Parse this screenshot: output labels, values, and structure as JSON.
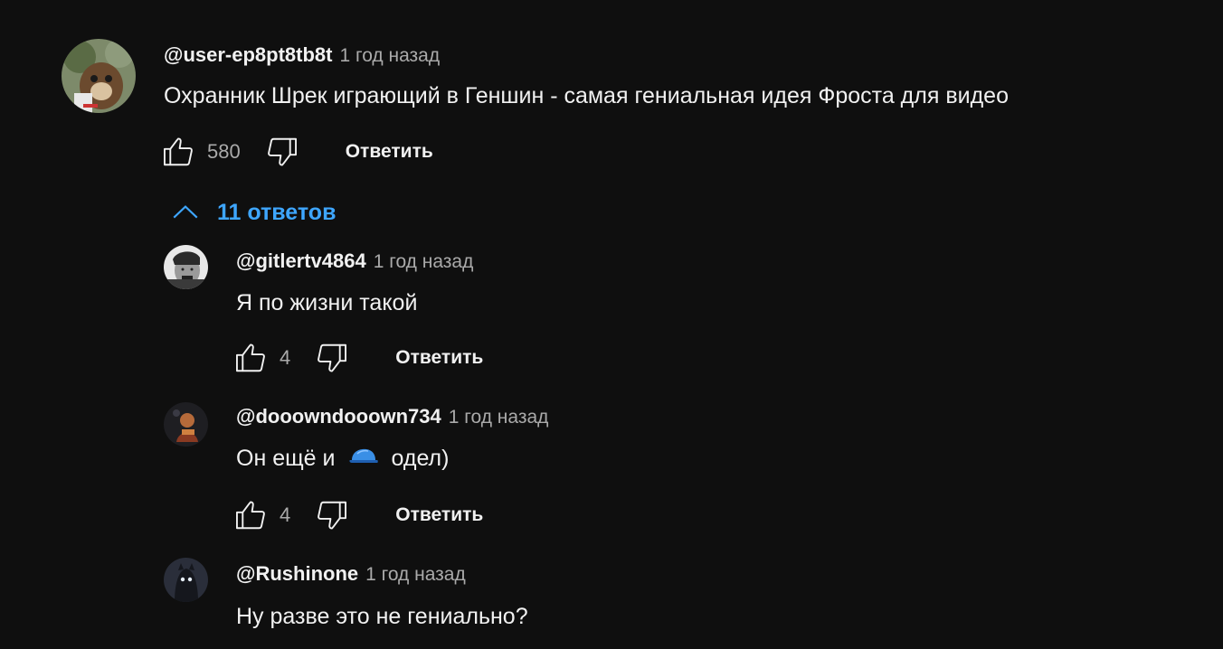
{
  "comment": {
    "author": "@user-ep8pt8tb8t",
    "time": "1 год назад",
    "text": "Охранник Шрек играющий в Геншин - самая гениальная идея Фроста для видео",
    "likes": "580",
    "reply_label": "Ответить",
    "avatar_icon": "bear-avatar"
  },
  "replies_toggle": {
    "label": "11 ответов",
    "icon": "chevron-up-icon",
    "color": "#3ea6ff"
  },
  "replies": [
    {
      "author": "@gitlertv4864",
      "time": "1 год назад",
      "text": "Я по жизни такой",
      "likes": "4",
      "reply_label": "Ответить"
    },
    {
      "author": "@dooowndooown734",
      "time": "1 год назад",
      "text_before": "Он ещё и",
      "emoji": "blue-cap-emoji",
      "text_after": "одел)",
      "likes": "4",
      "reply_label": "Ответить"
    },
    {
      "author": "@Rushinone",
      "time": "1 год назад",
      "text": "Ну разве это не гениально?"
    }
  ]
}
